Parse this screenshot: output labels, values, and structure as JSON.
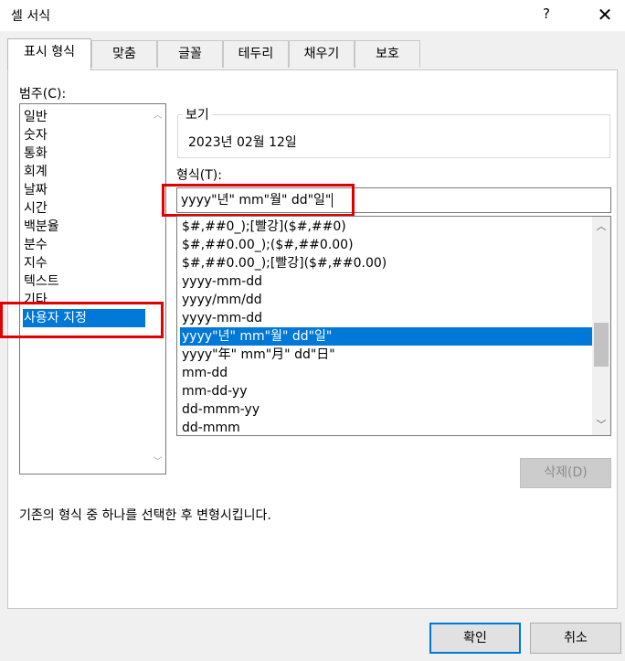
{
  "window": {
    "title": "셀 서식",
    "help_label": "?",
    "close_label": "✕"
  },
  "tabs": [
    {
      "label": "표시 형식",
      "active": true
    },
    {
      "label": "맞춤",
      "active": false
    },
    {
      "label": "글꼴",
      "active": false
    },
    {
      "label": "테두리",
      "active": false
    },
    {
      "label": "채우기",
      "active": false
    },
    {
      "label": "보호",
      "active": false
    }
  ],
  "category": {
    "label": "범주(C):",
    "items": [
      "일반",
      "숫자",
      "통화",
      "회계",
      "날짜",
      "시간",
      "백분율",
      "분수",
      "지수",
      "텍스트",
      "기타",
      "사용자 지정"
    ],
    "selected": "사용자 지정"
  },
  "preview": {
    "legend": "보기",
    "value": "2023년 02월 12일"
  },
  "format": {
    "label": "형식(T):",
    "value": "yyyy\"년\" mm\"월\" dd\"일\"",
    "items": [
      "$#,##0_);[빨강]($#,##0)",
      "$#,##0.00_);($#,##0.00)",
      "$#,##0.00_);[빨강]($#,##0.00)",
      "yyyy-mm-dd",
      "yyyy/mm/dd",
      "yyyy-mm-dd",
      "yyyy\"년\" mm\"월\" dd\"일\"",
      "yyyy\"年\" mm\"月\" dd\"日\"",
      "mm-dd",
      "mm-dd-yy",
      "dd-mmm-yy",
      "dd-mmm"
    ],
    "selected_index": 6
  },
  "buttons": {
    "delete": "삭제(D)",
    "ok": "확인",
    "cancel": "취소"
  },
  "description": "기존의 형식 중 하나를 선택한 후 변형시킵니다.",
  "colors": {
    "selection": "#0078d7",
    "highlight_box": "#e00000",
    "dialog_bg": "#f0f0f0"
  }
}
